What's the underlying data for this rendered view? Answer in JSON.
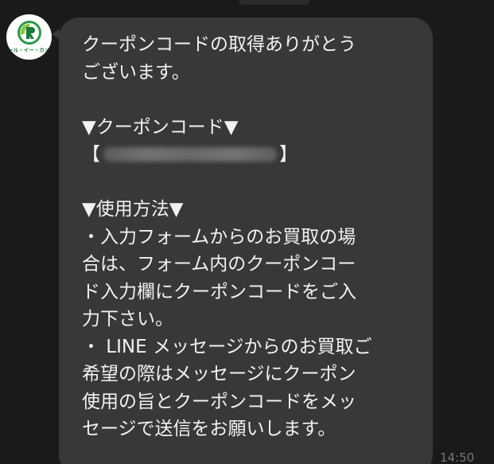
{
  "app": {
    "background_color": "#1a1a1a",
    "bubble_color": "#383838",
    "text_color": "#f2f2f2",
    "brand_color": "#1a7a3a"
  },
  "sender": {
    "avatar_icon": "brand-logo-icon",
    "avatar_caption": "アール・イー・カメラ"
  },
  "message": {
    "lines": [
      "クーポンコードの取得ありがとう",
      "ございます。",
      "",
      "▼クーポンコード▼"
    ],
    "code_prefix": "【",
    "code_suffix": "】",
    "code_value_redacted": "blurred",
    "lines_after": [
      "",
      "▼使用方法▼",
      "・入力フォームからのお買取の場",
      "合は、フォーム内のクーポンコー",
      "ド入力欄にクーポンコードをご入",
      "力下さい。",
      "・ LINE メッセージからのお買取ご",
      "希望の際はメッセージにクーポン",
      "使用の旨とクーポンコードをメッ",
      "セージで送信をお願いします。"
    ]
  },
  "timestamp": "14:50"
}
